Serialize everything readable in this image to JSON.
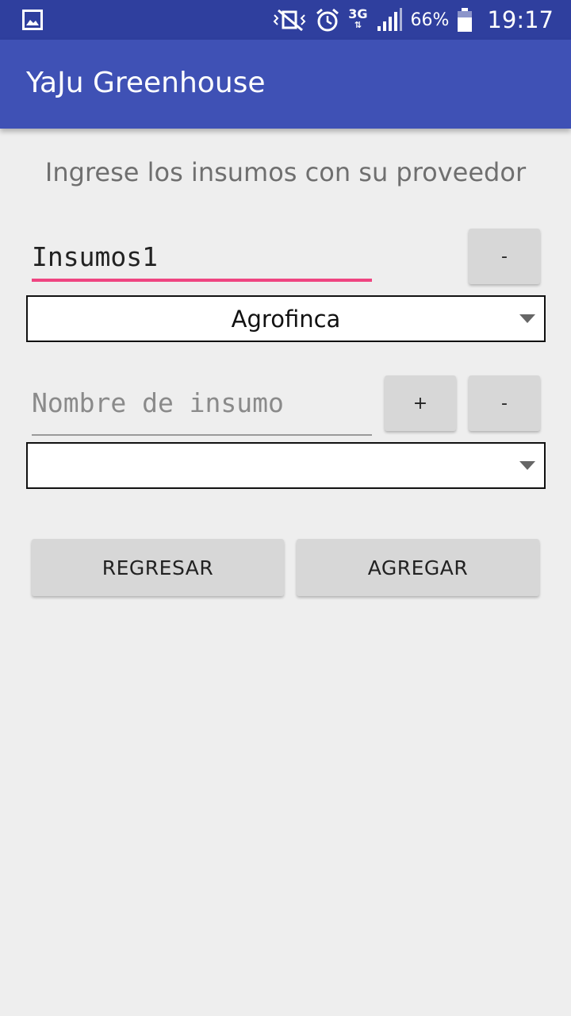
{
  "status_bar": {
    "battery": "66%",
    "time": "19:17",
    "network": "3G",
    "icons": [
      "image-icon",
      "vibrate-icon",
      "alarm-icon",
      "3g-icon",
      "signal-icon",
      "battery-icon"
    ]
  },
  "app_bar": {
    "title": "YaJu Greenhouse"
  },
  "form": {
    "heading": "Ingrese los insumos con su proveedor",
    "rows": [
      {
        "input_value": "Insumos1",
        "remove_label": "-",
        "supplier_selected": "Agrofinca"
      },
      {
        "input_placeholder": "Nombre de insumo",
        "add_label": "+",
        "remove_label": "-",
        "supplier_selected": ""
      }
    ],
    "back_label": "REGRESAR",
    "add_label": "AGREGAR"
  },
  "colors": {
    "status_bar": "#2f3f9e",
    "app_bar": "#3f51b5",
    "accent": "#ef4581",
    "background": "#eeeeee",
    "button": "#d7d7d7"
  }
}
